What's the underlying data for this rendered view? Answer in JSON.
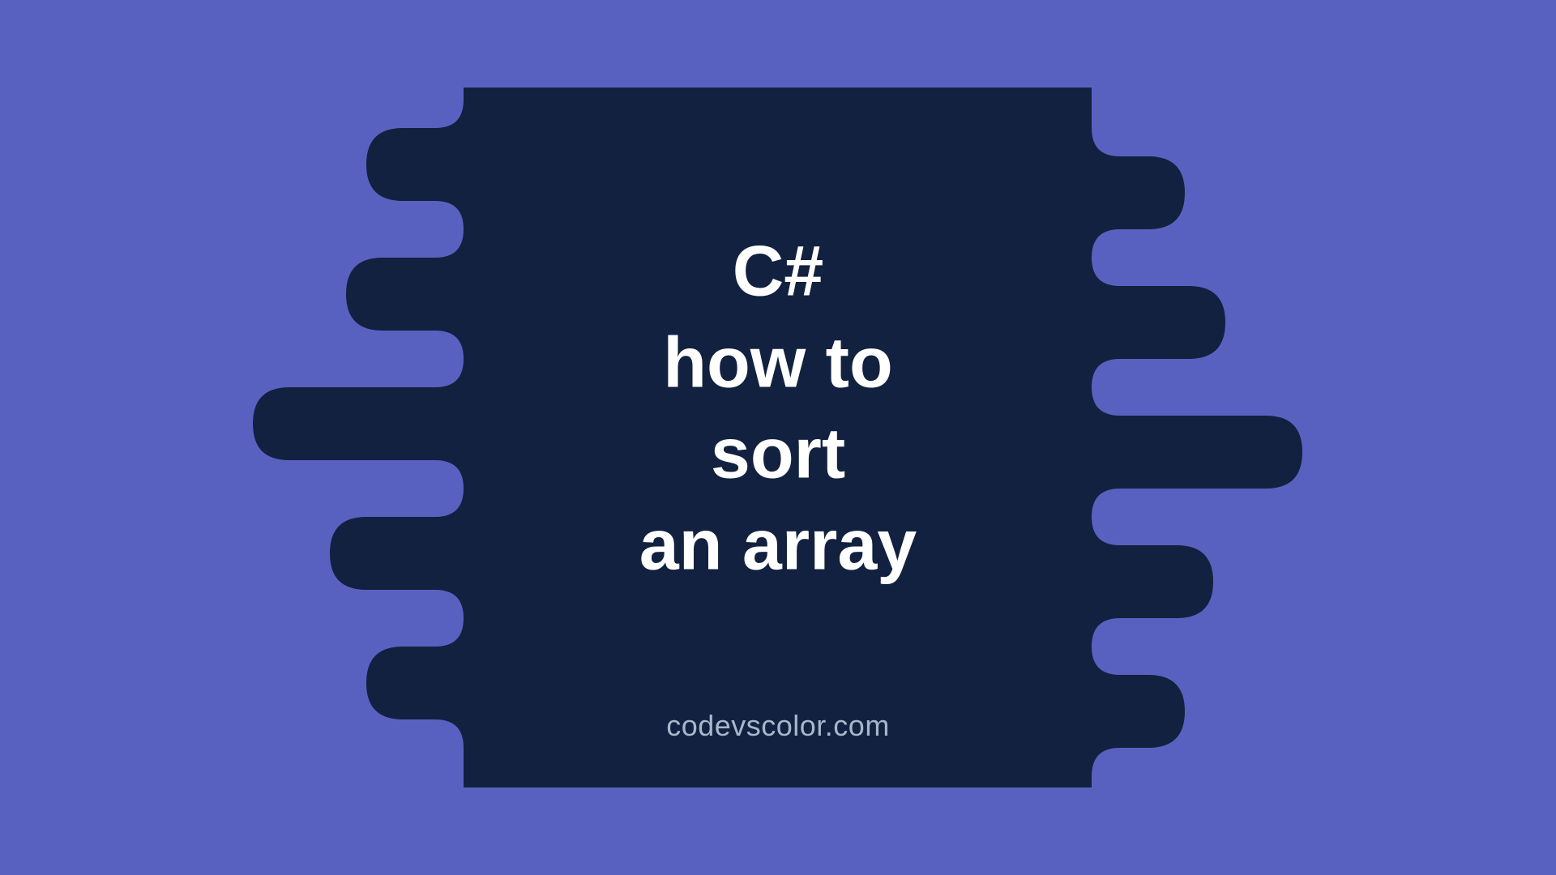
{
  "colors": {
    "background": "#5961c0",
    "blob": "#12213f",
    "text": "#ffffff",
    "footer": "#a8b5cb"
  },
  "title": {
    "line1": "C#",
    "line2": "how to",
    "line3": "sort",
    "line4": "an array"
  },
  "footer": "codevscolor.com"
}
